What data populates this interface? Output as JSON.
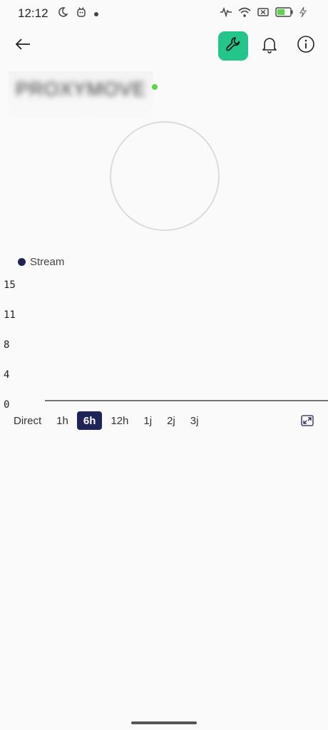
{
  "status_bar": {
    "time": "12:12",
    "left_icons": [
      "moon-icon",
      "assistant-icon",
      "notification-dot-icon"
    ],
    "right_icons": [
      "signal-wave-icon",
      "wifi-icon",
      "no-sim-icon",
      "battery-icon",
      "charging-icon"
    ],
    "battery_level": 0.6,
    "battery_color": "#5fd34a"
  },
  "app_bar": {
    "back_icon": "arrow-left-icon",
    "tool_icon": "wrench-icon",
    "bell_icon": "bell-icon",
    "info_icon": "info-icon",
    "tool_bg_color": "#25c48a"
  },
  "device": {
    "name": "PROXYMOVE",
    "online_color": "#5fd34a"
  },
  "chart_data": {
    "type": "line",
    "series": [
      {
        "name": "Stream",
        "color": "#1f2456",
        "values": []
      }
    ],
    "y_ticks": [
      "15",
      "11",
      "8",
      "4",
      "0"
    ],
    "ylim": [
      0,
      15
    ],
    "grid": false,
    "legend": "top-left"
  },
  "time_ranges": {
    "options": [
      "Direct",
      "1h",
      "6h",
      "12h",
      "1j",
      "2j",
      "3j"
    ],
    "selected": "6h"
  },
  "expand_icon": "expand-icon"
}
